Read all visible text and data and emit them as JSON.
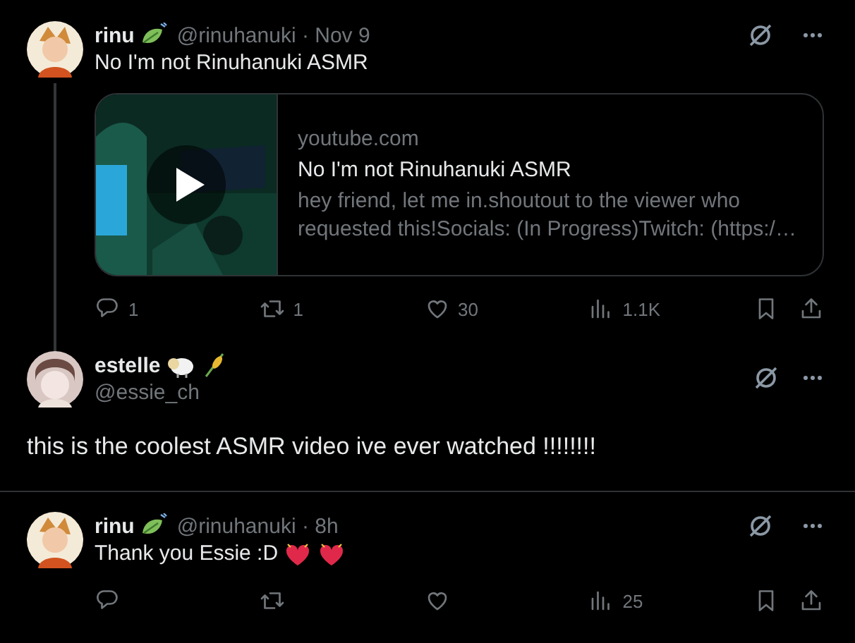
{
  "tweets": [
    {
      "kind": "thread",
      "author": {
        "name": "rinu",
        "meta": "@rinuhanuki · Nov 9"
      },
      "text": "No I'm not Rinuhanuki ASMR",
      "card": {
        "domain": "youtube.com",
        "title": "No I'm not Rinuhanuki ASMR",
        "description": "hey friend, let me in.shoutout to the viewer who requested this!Socials: (In Progress)Twitch: (https:/…"
      },
      "actions": {
        "replies": "1",
        "reposts": "1",
        "likes": "30",
        "views": "1.1K"
      }
    },
    {
      "kind": "focused",
      "author": {
        "name": "estelle",
        "meta": "@essie_ch"
      },
      "text": "this is the coolest ASMR video ive ever watched !!!!!!!!"
    },
    {
      "kind": "reply",
      "author": {
        "name": "rinu",
        "meta": "@rinuhanuki · 8h"
      },
      "text": "Thank you Essie :D",
      "actions": {
        "views": "25"
      }
    }
  ]
}
